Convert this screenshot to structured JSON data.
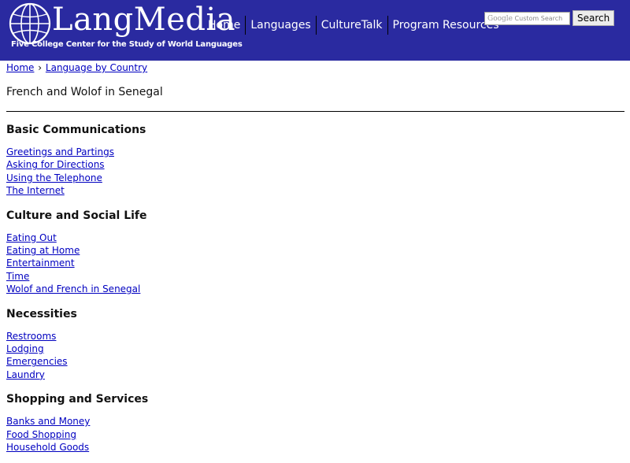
{
  "header": {
    "brand": "LangMedia",
    "tagline": "Five College Center for the Study of World Languages",
    "nav": [
      "Home",
      "Languages",
      "CultureTalk",
      "Program Resources"
    ],
    "search": {
      "placeholder_brand": "Google",
      "placeholder_text": "Custom Search",
      "button": "Search"
    },
    "colors": {
      "bar": "#2a2aa0",
      "link": "#0000c0"
    }
  },
  "breadcrumb": {
    "home": "Home",
    "sep": "›",
    "section": "Language by Country"
  },
  "page_title": "French and Wolof in Senegal",
  "sections": [
    {
      "heading": "Basic Communications",
      "links": [
        "Greetings and Partings",
        "Asking for Directions",
        "Using the Telephone",
        "The Internet"
      ]
    },
    {
      "heading": "Culture and Social Life",
      "links": [
        "Eating Out",
        "Eating at Home",
        "Entertainment",
        "Time",
        "Wolof and French in Senegal"
      ]
    },
    {
      "heading": "Necessities",
      "links": [
        "Restrooms",
        "Lodging",
        "Emergencies",
        "Laundry"
      ]
    },
    {
      "heading": "Shopping and Services",
      "links": [
        "Banks and Money",
        "Food Shopping",
        "Household Goods"
      ]
    }
  ]
}
